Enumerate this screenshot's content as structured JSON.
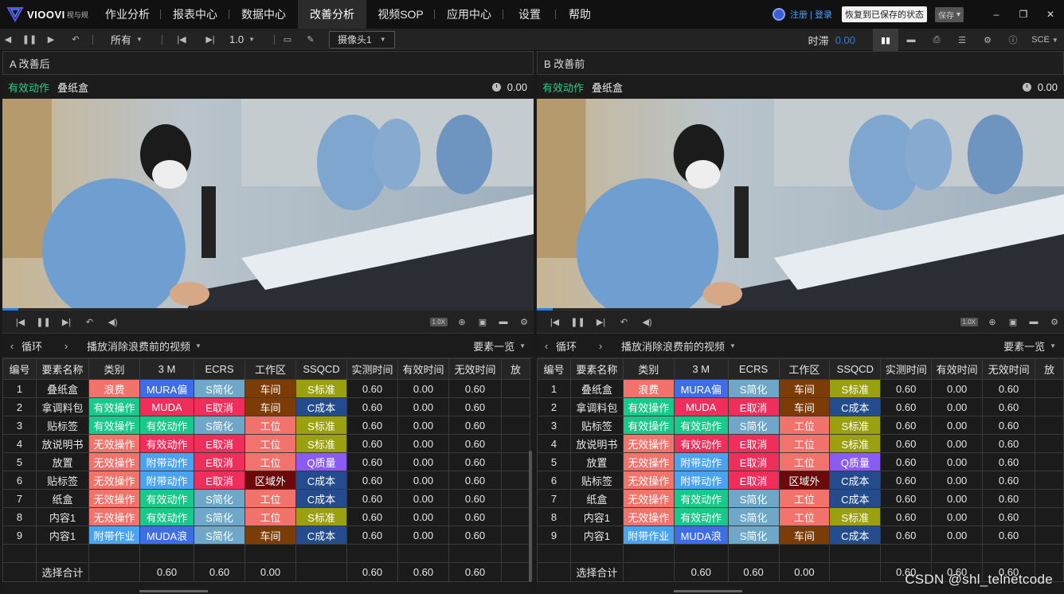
{
  "app": {
    "logo_text": "VIOOVI",
    "logo_sub": "视与规",
    "nav": [
      "作业分析",
      "报表中心",
      "数据中心",
      "改善分析",
      "视频SOP",
      "应用中心",
      "设置",
      "帮助"
    ],
    "active_nav": "改善分析",
    "login": "注册 | 登录",
    "restore": "恢复到已保存的状态",
    "save": "保存"
  },
  "toolbar": {
    "filter": "所有",
    "speed": "1.0",
    "camera": "摄像头1",
    "delay_label": "时滞",
    "delay_value": "0.00",
    "sce": "SCE"
  },
  "panels": [
    {
      "title": "A 改善后",
      "action_type": "有效动作",
      "action_name": "叠纸盒",
      "time": "0.00",
      "progress": 0.03,
      "speed_badge": "1.0X",
      "loop": "循环",
      "video_title": "播放消除浪费前的视频",
      "element_list": "要素一览"
    },
    {
      "title": "B 改善前",
      "action_type": "有效动作",
      "action_name": "叠纸盒",
      "time": "0.00",
      "progress": 0.03,
      "speed_badge": "1.0X",
      "loop": "循环",
      "video_title": "播放消除浪费前的视频",
      "element_list": "要素一览"
    }
  ],
  "table": {
    "headers": [
      "编号",
      "要素名称",
      "类别",
      "3 M",
      "ECRS",
      "工作区",
      "SSQCD",
      "实测时间",
      "有效时间",
      "无效时间",
      "放"
    ],
    "rows": [
      {
        "no": "1",
        "name": "叠纸盒",
        "cat": "浪费",
        "m3": "MURA偏",
        "ecrs": "S简化",
        "area": "车间",
        "ssqcd": "S标准",
        "t1": "0.60",
        "t2": "0.00",
        "t3": "0.60"
      },
      {
        "no": "2",
        "name": "拿调料包",
        "cat": "有效操作",
        "m3": "MUDA",
        "ecrs": "E取消",
        "area": "车间",
        "ssqcd": "C成本",
        "t1": "0.60",
        "t2": "0.00",
        "t3": "0.60"
      },
      {
        "no": "3",
        "name": "贴标签",
        "cat": "有效操作",
        "m3": "有效动作",
        "ecrs": "S简化",
        "area": "工位",
        "ssqcd": "S标准",
        "t1": "0.60",
        "t2": "0.00",
        "t3": "0.60"
      },
      {
        "no": "4",
        "name": "放说明书",
        "cat": "无效操作",
        "m3": "有效动作",
        "ecrs": "E取消",
        "area": "工位",
        "ssqcd": "S标准",
        "t1": "0.60",
        "t2": "0.00",
        "t3": "0.60"
      },
      {
        "no": "5",
        "name": "放置",
        "cat": "无效操作",
        "m3": "附带动作",
        "ecrs": "E取消",
        "area": "工位",
        "ssqcd": "Q质量",
        "t1": "0.60",
        "t2": "0.00",
        "t3": "0.60"
      },
      {
        "no": "6",
        "name": "贴标签",
        "cat": "无效操作",
        "m3": "附带动作",
        "ecrs": "E取消",
        "area": "区域外",
        "ssqcd": "C成本",
        "t1": "0.60",
        "t2": "0.00",
        "t3": "0.60"
      },
      {
        "no": "7",
        "name": "纸盒",
        "cat": "无效操作",
        "m3": "有效动作",
        "ecrs": "S简化",
        "area": "工位",
        "ssqcd": "C成本",
        "t1": "0.60",
        "t2": "0.00",
        "t3": "0.60"
      },
      {
        "no": "8",
        "name": "内容1",
        "cat": "无效操作",
        "m3": "有效动作",
        "ecrs": "S简化",
        "area": "工位",
        "ssqcd": "S标准",
        "t1": "0.60",
        "t2": "0.00",
        "t3": "0.60"
      },
      {
        "no": "9",
        "name": "内容1",
        "cat": "附带作业",
        "m3": "MUDA浪",
        "ecrs": "S简化",
        "area": "车间",
        "ssqcd": "C成本",
        "t1": "0.60",
        "t2": "0.00",
        "t3": "0.60"
      }
    ],
    "total": {
      "label": "选择合计",
      "m3": "0.60",
      "ecrs": "0.60",
      "area": "0.00",
      "t1": "0.60",
      "t2": "0.60",
      "t3": "0.60"
    }
  },
  "watermark": "CSDN @shl_telnetcode"
}
